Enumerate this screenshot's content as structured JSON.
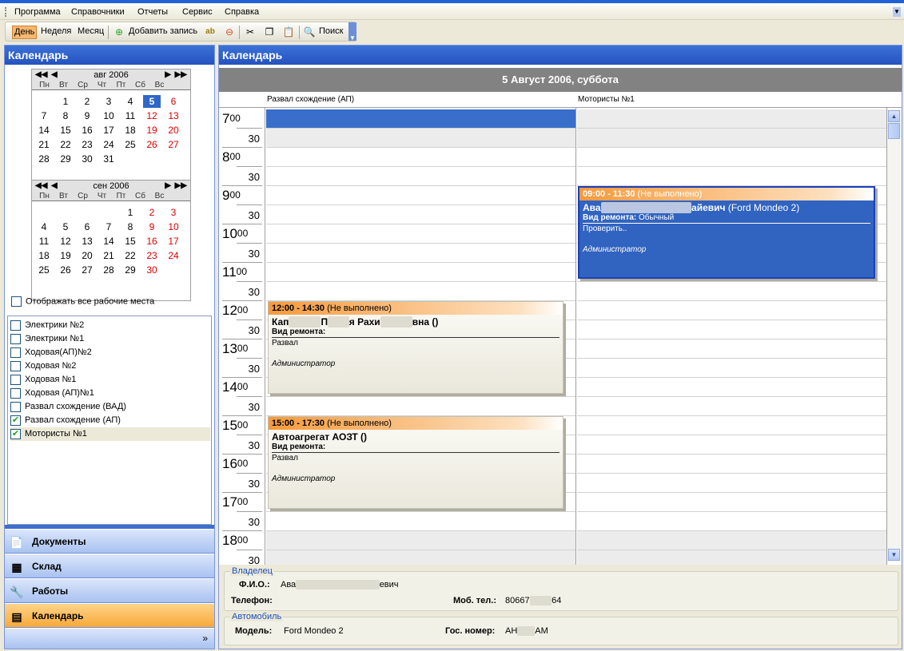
{
  "menu": [
    "Программа",
    "Справочники",
    "Отчеты",
    "Сервис",
    "Справка"
  ],
  "toolbar": {
    "day": "День",
    "week": "Неделя",
    "month": "Месяц",
    "add": "Добавить запись",
    "search": "Поиск"
  },
  "left": {
    "title": "Календарь",
    "cal1": {
      "month": "авг 2006",
      "dows": [
        "Пн",
        "Вт",
        "Ср",
        "Чт",
        "Пт",
        "Сб",
        "Вс"
      ],
      "weeks": [
        [
          "",
          "",
          "1",
          "2",
          "3",
          "4",
          "5",
          "6"
        ],
        [
          "7",
          "8",
          "9",
          "10",
          "11",
          "12",
          "13"
        ],
        [
          "14",
          "15",
          "16",
          "17",
          "18",
          "19",
          "20"
        ],
        [
          "21",
          "22",
          "23",
          "24",
          "25",
          "26",
          "27"
        ],
        [
          "28",
          "29",
          "30",
          "31"
        ]
      ],
      "selected_day": "5"
    },
    "cal2": {
      "month": "сен 2006",
      "dows": [
        "Пн",
        "Вт",
        "Ср",
        "Чт",
        "Пт",
        "Сб",
        "Вс"
      ],
      "weeks": [
        [
          "1",
          "2",
          "3"
        ],
        [
          "4",
          "5",
          "6",
          "7",
          "8",
          "9",
          "10"
        ],
        [
          "11",
          "12",
          "13",
          "14",
          "15",
          "16",
          "17"
        ],
        [
          "18",
          "19",
          "20",
          "21",
          "22",
          "23",
          "24"
        ],
        [
          "25",
          "26",
          "27",
          "28",
          "29",
          "30"
        ]
      ]
    },
    "show_all": "Отображать все рабочие места",
    "places": [
      {
        "label": "Электрики №2",
        "checked": false
      },
      {
        "label": "Электрики №1",
        "checked": false
      },
      {
        "label": "Ходовая(АП)№2",
        "checked": false
      },
      {
        "label": "Ходовая №2",
        "checked": false
      },
      {
        "label": "Ходовая №1",
        "checked": false
      },
      {
        "label": "Ходовая (АП)№1",
        "checked": false
      },
      {
        "label": "Развал схождение (ВАД)",
        "checked": false
      },
      {
        "label": "Развал схождение (АП)",
        "checked": true
      },
      {
        "label": "Мотористы №1",
        "checked": true
      }
    ],
    "nav": [
      "Документы",
      "Склад",
      "Работы",
      "Календарь"
    ]
  },
  "main": {
    "title": "Календарь",
    "date": "5 Август 2006, суббота",
    "columns": [
      "Развал схождение (АП)",
      "Мотористы №1"
    ],
    "hours": [
      "7",
      "8",
      "9",
      "10",
      "11",
      "12",
      "13",
      "14",
      "15",
      "16",
      "17",
      "18"
    ],
    "minutes_00": "00",
    "minutes_30": "30",
    "appointments": [
      {
        "time": "09:00 - 11:30",
        "status": "(Не выполнено)",
        "name_start": "Ава",
        "name_end": "айевич",
        "car": "(Ford Mondeo 2)",
        "repair_label": "Вид ремонта:",
        "repair_value": "Обычный",
        "note": "Проверить..",
        "author": "Администратор"
      },
      {
        "time": "12:00 - 14:30",
        "status": "(Не выполнено)",
        "name_start": "Кап",
        "name_mid": "П",
        "name_rest": "я Рахи",
        "name_end": "вна ()",
        "repair_label": "Вид ремонта:",
        "note": "Развал",
        "author": "Администратор"
      },
      {
        "time": "15:00 - 17:30",
        "status": "(Не выполнено)",
        "name": "Автоагрегат АОЗТ ()",
        "repair_label": "Вид ремонта:",
        "note": "Развал",
        "author": "Администратор"
      }
    ]
  },
  "details": {
    "owner_group": "Владелец",
    "fio_label": "Ф.И.О.:",
    "fio_start": "Ава",
    "fio_end": "евич",
    "phone_label": "Телефон:",
    "mobile_label": "Моб. тел.:",
    "mobile_start": "80667",
    "mobile_end": "64",
    "car_group": "Автомобиль",
    "model_label": "Модель:",
    "model_value": "Ford Mondeo 2",
    "plate_label": "Гос. номер:",
    "plate_start": "АН",
    "plate_end": "AM"
  }
}
